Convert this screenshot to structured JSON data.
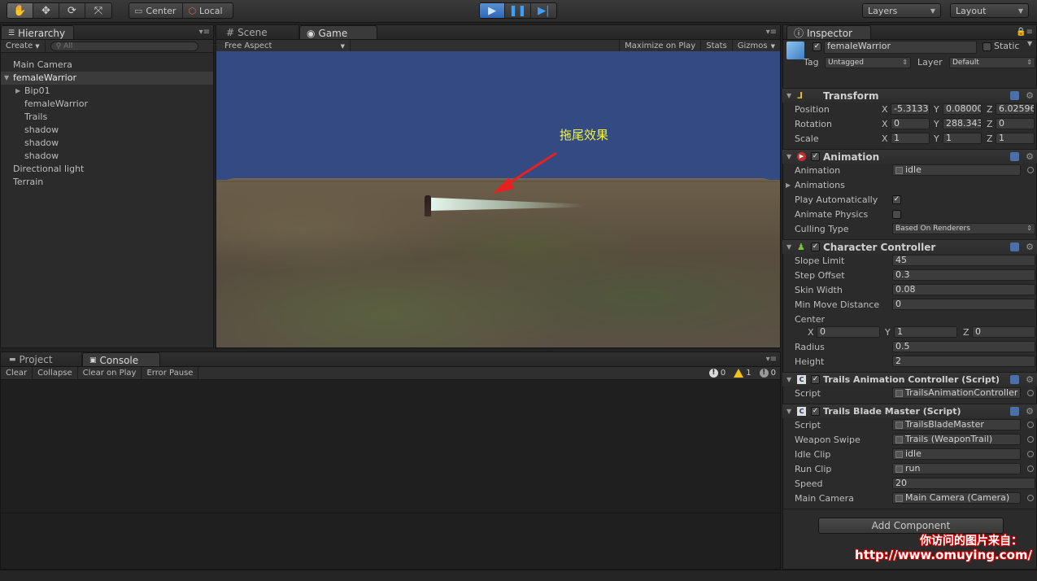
{
  "toolbar": {
    "pivot": "Center",
    "space": "Local",
    "layers_label": "Layers",
    "layout_label": "Layout"
  },
  "hierarchy": {
    "tab": "Hierarchy",
    "create": "Create",
    "search_placeholder": "All",
    "items": [
      {
        "label": "Main Camera",
        "indent": 0,
        "selected": false
      },
      {
        "label": "femaleWarrior",
        "indent": 0,
        "selected": true,
        "expanded": true
      },
      {
        "label": "Bip01",
        "indent": 1,
        "collapsed": true
      },
      {
        "label": "femaleWarrior",
        "indent": 1
      },
      {
        "label": "Trails",
        "indent": 1
      },
      {
        "label": "shadow",
        "indent": 1
      },
      {
        "label": "shadow",
        "indent": 1
      },
      {
        "label": "shadow",
        "indent": 1
      },
      {
        "label": "Directional light",
        "indent": 0
      },
      {
        "label": "Terrain",
        "indent": 0
      }
    ]
  },
  "scene_tabs": {
    "scene": "Scene",
    "game": "Game",
    "aspect": "Free Aspect",
    "maximize": "Maximize on Play",
    "stats": "Stats",
    "gizmos": "Gizmos"
  },
  "game_view": {
    "annotation": "拖尾效果"
  },
  "bottom_tabs": {
    "project": "Project",
    "console": "Console",
    "clear": "Clear",
    "collapse": "Collapse",
    "clear_on_play": "Clear on Play",
    "error_pause": "Error Pause",
    "errors": "0",
    "warnings": "1",
    "logs": "0"
  },
  "inspector": {
    "tab": "Inspector",
    "object_name": "femaleWarrior",
    "static_label": "Static",
    "tag_label": "Tag",
    "tag_value": "Untagged",
    "layer_label": "Layer",
    "layer_value": "Default",
    "transform": {
      "title": "Transform",
      "position_label": "Position",
      "rotation_label": "Rotation",
      "scale_label": "Scale",
      "position": [
        "-5.3133",
        "0.08000",
        "6.02596"
      ],
      "rotation": [
        "0",
        "288.343",
        "0"
      ],
      "scale": [
        "1",
        "1",
        "1"
      ]
    },
    "animation": {
      "title": "Animation",
      "animation_label": "Animation",
      "animation_value": "idle",
      "animations_label": "Animations",
      "play_auto_label": "Play Automatically",
      "play_auto": true,
      "animate_physics_label": "Animate Physics",
      "animate_physics": false,
      "culling_label": "Culling Type",
      "culling_value": "Based On Renderers"
    },
    "character_controller": {
      "title": "Character Controller",
      "slope_label": "Slope Limit",
      "slope": "45",
      "step_label": "Step Offset",
      "step": "0.3",
      "skin_label": "Skin Width",
      "skin": "0.08",
      "minmove_label": "Min Move Distance",
      "minmove": "0",
      "center_label": "Center",
      "center": [
        "0",
        "1",
        "0"
      ],
      "radius_label": "Radius",
      "radius": "0.5",
      "height_label": "Height",
      "height": "2"
    },
    "trails_anim": {
      "title": "Trails Animation Controller (Script)",
      "script_label": "Script",
      "script_value": "TrailsAnimationController"
    },
    "trails_blade": {
      "title": "Trails Blade Master (Script)",
      "script_label": "Script",
      "script_value": "TrailsBladeMaster",
      "weapon_label": "Weapon Swipe",
      "weapon_value": "Trails (WeaponTrail)",
      "idle_label": "Idle Clip",
      "idle_value": "idle",
      "run_label": "Run Clip",
      "run_value": "run",
      "speed_label": "Speed",
      "speed_value": "20",
      "camera_label": "Main Camera",
      "camera_value": "Main Camera (Camera)"
    },
    "add_component": "Add Component"
  },
  "watermark": {
    "line1": "你访问的图片来自：",
    "line2": "http://www.omuying.com/"
  },
  "colors": {
    "sky": "#334b82",
    "annotation": "#f5f53a",
    "arrow": "#e82020",
    "play_active": "#2f67b5"
  }
}
